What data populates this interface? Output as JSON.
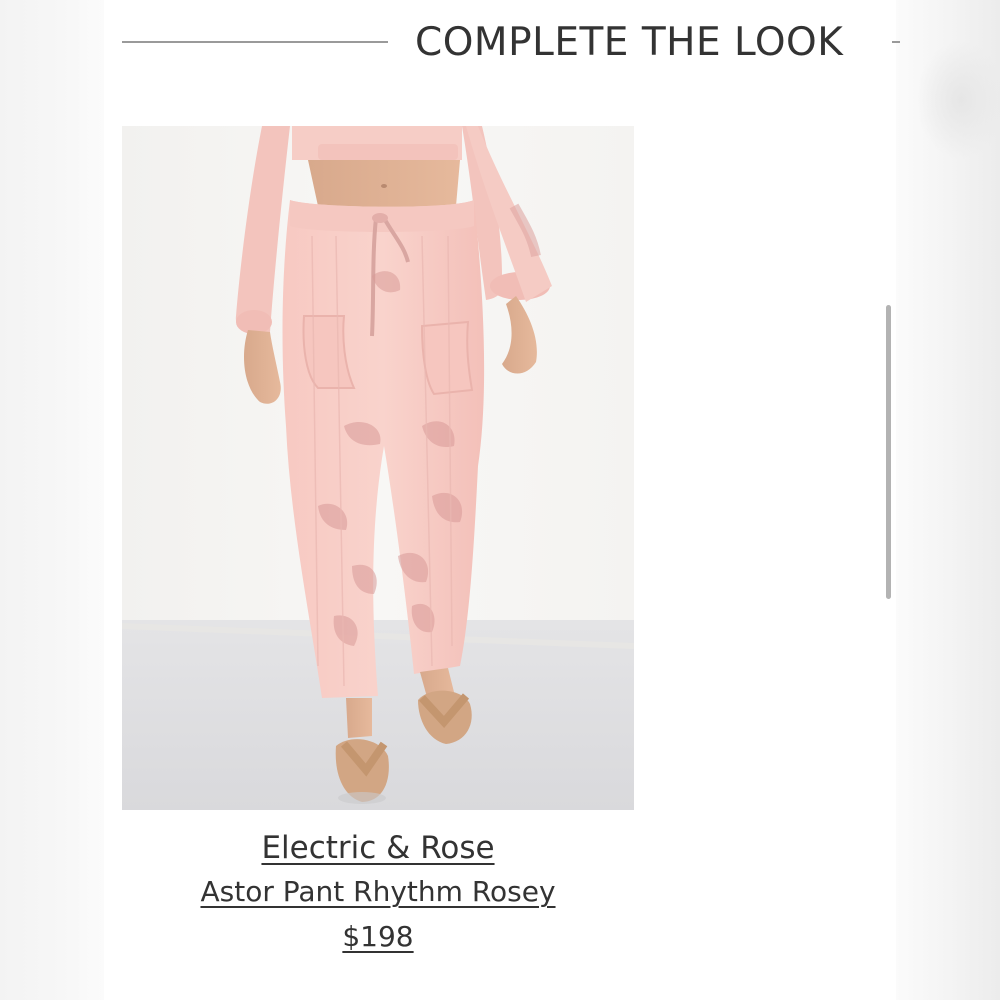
{
  "section": {
    "title": "COMPLETE THE LOOK"
  },
  "product": {
    "brand": "Electric & Rose",
    "name": "Astor Pant Rhythm Rosey",
    "price": "$198",
    "image_alt": "Model wearing pink tie-dye pants with matching cropped top and tan sandals"
  },
  "colors": {
    "text": "#333333",
    "rule": "#9a9a9a",
    "garment_pink": "#f4c2bd",
    "garment_dye": "#d99a98",
    "scrollbar": "#b3b3b3"
  }
}
